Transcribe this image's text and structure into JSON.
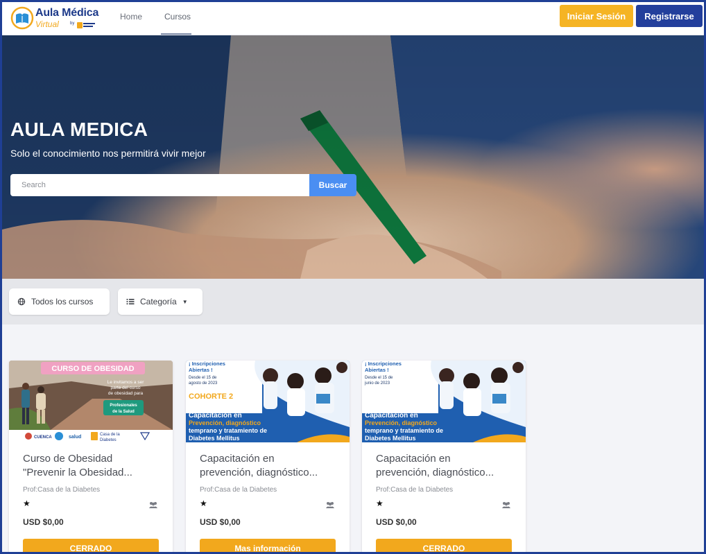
{
  "brand": {
    "title": "Aula Médica",
    "subtitle": "Virtual",
    "by": "by"
  },
  "nav": {
    "items": [
      {
        "label": "Home"
      },
      {
        "label": "Cursos"
      }
    ],
    "login_label": "Iniciar Sesión",
    "register_label": "Registrarse"
  },
  "hero": {
    "title": "AULA MEDICA",
    "subtitle": "Solo el conocimiento nos permitirá vivir mejor",
    "search_placeholder": "Search",
    "search_button": "Buscar"
  },
  "filters": {
    "all_courses": "Todos los cursos",
    "category": "Categoría"
  },
  "courses": [
    {
      "title_line1": "Curso de Obesidad",
      "title_line2": "\"Prevenir la Obesidad...",
      "prof": "Prof:Casa de la Diabetes",
      "price": "USD $0,00",
      "button": "CERRADO",
      "poster": {
        "headline": "CURSO DE OBESIDAD",
        "invite1": "Le invitamos a ser",
        "invite2": "parte del curso",
        "invite3": "de obesidad para",
        "audience1": "Profesionales",
        "audience2": "de la Salud",
        "logo1": "CUENCA",
        "logo2": "salud",
        "logo3a": "Casa de la",
        "logo3b": "Diabetes"
      }
    },
    {
      "title_line1": "Capacitación en",
      "title_line2": "prevención, diagnóstico...",
      "prof": "Prof:Casa de la Diabetes",
      "price": "USD $0,00",
      "button": "Mas información",
      "poster": {
        "open1": "¡ Inscripciones",
        "open2": "Abiertas !",
        "date1": "Desde el 15 de",
        "date2": "agosto de 2023",
        "cohort": "COHORTE 2",
        "headline1": "Capacitación en",
        "headline2": "Prevención, diagnóstico",
        "headline3": "temprano y tratamiento de",
        "headline4": "Diabetes Mellitus"
      }
    },
    {
      "title_line1": "Capacitación en",
      "title_line2": "prevención, diagnóstico...",
      "prof": "Prof:Casa de la Diabetes",
      "price": "USD $0,00",
      "button": "CERRADO",
      "poster": {
        "open1": "¡ Inscripciones",
        "open2": "Abiertas !",
        "date1": "Desde el 15 de",
        "date2": "junio de 2023",
        "headline1": "Capacitación en",
        "headline2": "Prevención, diagnóstico",
        "headline3": "temprano y tratamiento de",
        "headline4": "Diabetes Mellitus"
      }
    }
  ],
  "icons": {
    "globe": "globe-icon",
    "list": "list-icon",
    "caret": "caret-down-icon",
    "star": "star-icon",
    "users": "users-icon"
  },
  "colors": {
    "brand_blue": "#233f9c",
    "accent_yellow": "#f5b424",
    "search_blue": "#4a8ef2",
    "card_button": "#f2a81d",
    "frame_border": "#1f3f95"
  }
}
